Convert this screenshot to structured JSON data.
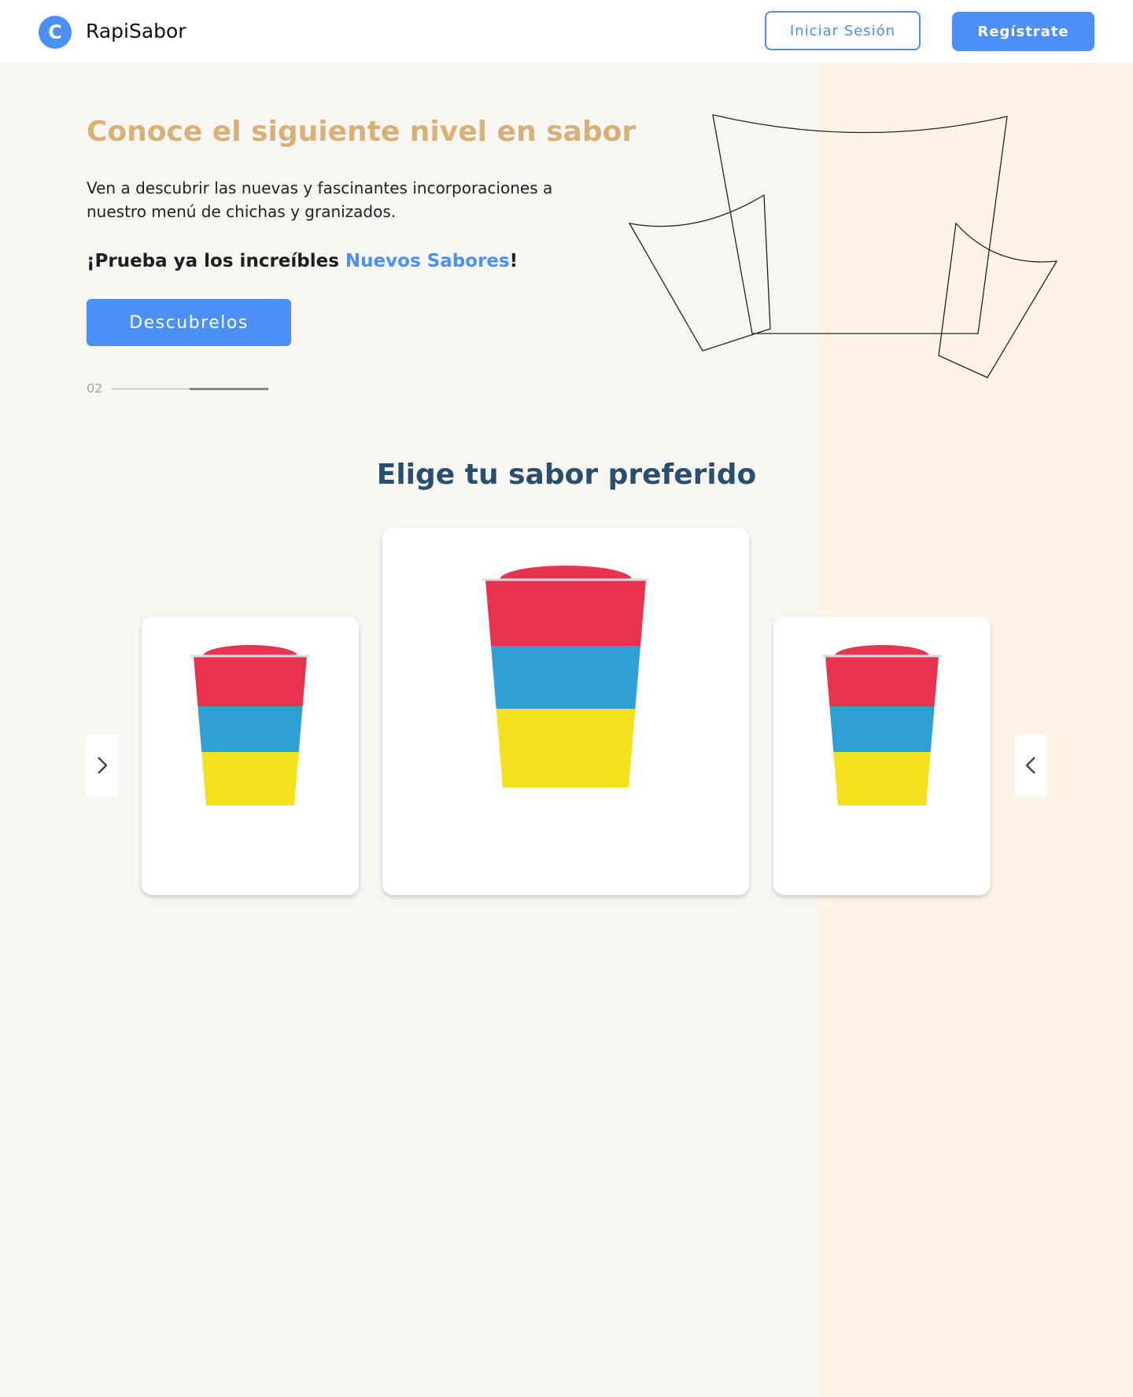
{
  "header": {
    "logo_letter": "C",
    "brand": "RapiSabor",
    "login_label": "Iniciar Sesión",
    "register_label": "Regístrate"
  },
  "hero": {
    "title": "Conoce el siguiente nivel en sabor",
    "description": "Ven a descubrir las nuevas y fascinantes incorporaciones a nuestro menú de chichas y granizados.",
    "cta_prefix": "¡Prueba ya los increíbles ",
    "cta_highlight": "Nuevos Sabores",
    "cta_suffix": "!",
    "button_label": "Descubrelos",
    "slide_number": "02",
    "slide_progress": 0.5
  },
  "flavors": {
    "title": "Elige tu sabor preferido",
    "cards": [
      {
        "name": "granizado-tricolor",
        "colors": [
          "#e8334f",
          "#2f9fd4",
          "#f4e01d"
        ]
      },
      {
        "name": "granizado-tricolor",
        "colors": [
          "#e8334f",
          "#2f9fd4",
          "#f4e01d"
        ]
      },
      {
        "name": "granizado-tricolor",
        "colors": [
          "#e8334f",
          "#2f9fd4",
          "#f4e01d"
        ]
      }
    ],
    "prev_icon": "chevron-right-icon",
    "next_icon": "chevron-left-icon"
  },
  "colors": {
    "accent": "#4b8ff7",
    "hero_title": "#d9b178",
    "section_title": "#2a4f6e",
    "background": "#f8f6f3",
    "right_panel": "#fef3e6"
  }
}
